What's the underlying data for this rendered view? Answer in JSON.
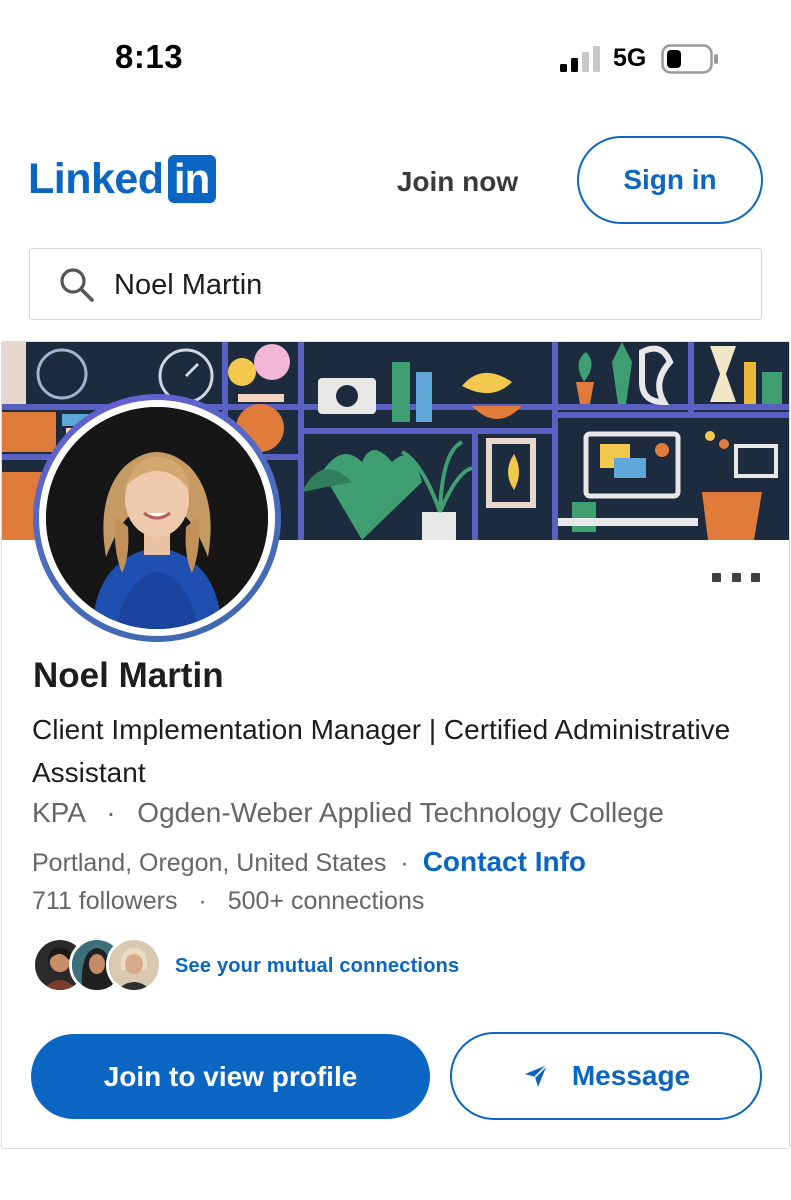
{
  "status_bar": {
    "time": "8:13",
    "network": "5G"
  },
  "header": {
    "logo_word": "Linked",
    "logo_box": "in",
    "join_now_label": "Join now",
    "sign_in_label": "Sign in"
  },
  "search": {
    "value": "Noel Martin"
  },
  "profile": {
    "name": "Noel Martin",
    "headline": "Client Implementation Manager | Certified Administrative Assistant",
    "company": "KPA",
    "school": "Ogden-Weber Applied Technology College",
    "location": "Portland, Oregon, United States",
    "contact_info_label": "Contact Info",
    "followers": "711 followers",
    "connections": "500+ connections",
    "mutual_connections_label": "See your mutual connections",
    "separator": "·"
  },
  "actions": {
    "join_profile_label": "Join to view profile",
    "message_label": "Message"
  },
  "icons": {
    "search": "search-icon",
    "send": "send-icon",
    "more": "more-icon",
    "signal": "signal-icon",
    "battery": "battery-icon"
  },
  "colors": {
    "brand_blue": "#0a66c2",
    "muted_text": "#666666",
    "primary_text": "#1d1d1d"
  }
}
